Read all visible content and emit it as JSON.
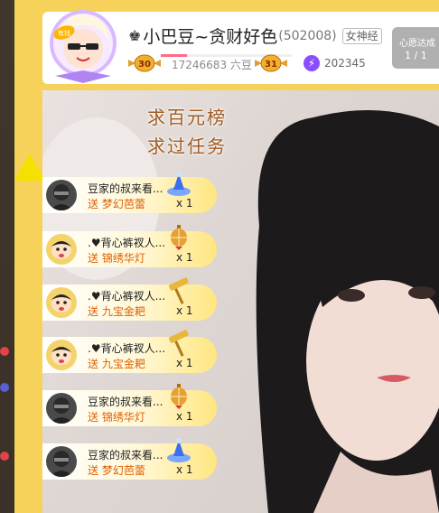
{
  "header": {
    "anchor_name": "小巴豆~贪财好色",
    "room_id": "(502008)",
    "tag": "女神经",
    "beans": "17246683 六豆",
    "level_left": "30",
    "level_right": "31",
    "level_progress": 0.2,
    "hot_value": "202345",
    "avatar_badge": "有钱"
  },
  "wish": {
    "title": "心愿达成",
    "count": "1 / 1"
  },
  "overlay": {
    "line1": "求百元榜",
    "line2": "求过任务"
  },
  "gifts": [
    {
      "sender": "豆家的叔来看...",
      "send": "送",
      "gift": "梦幻芭蕾",
      "count": "x 1",
      "avatar": "masked",
      "icon": "ballet"
    },
    {
      "sender": ".♥背心裤衩人...",
      "send": "送",
      "gift": "锦绣华灯",
      "count": "x 1",
      "avatar": "shinchan",
      "icon": "lantern"
    },
    {
      "sender": ".♥背心裤衩人...",
      "send": "送",
      "gift": "九宝金耙",
      "count": "x 1",
      "avatar": "shinchan",
      "icon": "rake"
    },
    {
      "sender": ".♥背心裤衩人...",
      "send": "送",
      "gift": "九宝金耙",
      "count": "x 1",
      "avatar": "shinchan",
      "icon": "rake"
    },
    {
      "sender": "豆家的叔来看...",
      "send": "送",
      "gift": "锦绣华灯",
      "count": "x 1",
      "avatar": "masked",
      "icon": "lantern"
    },
    {
      "sender": "豆家的叔来看...",
      "send": "送",
      "gift": "梦幻芭蕾",
      "count": "x 1",
      "avatar": "masked",
      "icon": "ballet"
    }
  ],
  "colors": {
    "frame": "#f6d25a",
    "accent_text": "#e06000",
    "overlay_text": "#a05c22"
  }
}
